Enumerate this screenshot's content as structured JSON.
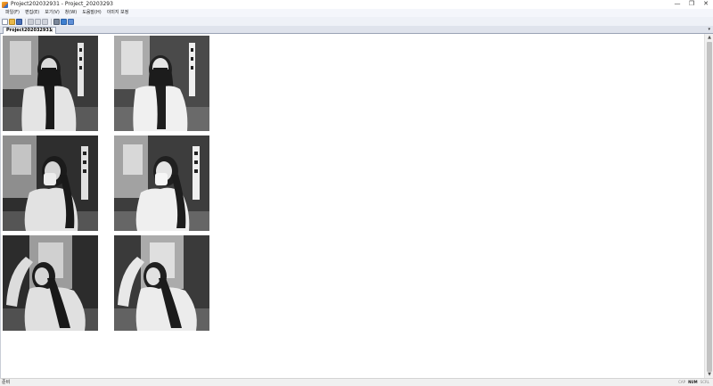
{
  "window": {
    "title": "Project202032931 - Project_20203293",
    "controls": {
      "minimize": "—",
      "maximize": "❐",
      "close": "✕"
    }
  },
  "menu": [
    "파일(F)",
    "편집(E)",
    "보기(V)",
    "창(W)",
    "도움말(H)",
    "이미지 보정"
  ],
  "toolbar": {
    "icons": [
      "new-file-icon",
      "open-folder-icon",
      "save-icon",
      "cut-icon",
      "copy-icon",
      "paste-icon",
      "print-icon",
      "about-icon",
      "help-icon"
    ]
  },
  "tabs": {
    "active_label": "Project202032931",
    "close": "✕",
    "dropdown": "▾"
  },
  "tiles": [
    {
      "name": "image-original-1",
      "pose": "face-mask"
    },
    {
      "name": "image-processed-1",
      "pose": "face-mask"
    },
    {
      "name": "image-original-2",
      "pose": "hand-cover"
    },
    {
      "name": "image-processed-2",
      "pose": "hand-cover"
    },
    {
      "name": "image-original-3",
      "pose": "arm-raised"
    },
    {
      "name": "image-processed-3",
      "pose": "arm-raised"
    }
  ],
  "scrollbar": {
    "up": "▲",
    "down": "▼"
  },
  "status": {
    "text": "준비",
    "indicators": [
      {
        "label": "CAP",
        "on": false
      },
      {
        "label": "NUM",
        "on": true
      },
      {
        "label": "SCRL",
        "on": false
      }
    ]
  },
  "colors": {
    "titlebar": "#ffffff",
    "menubar": "#f4f6fb",
    "client": "#ffffff",
    "status": "#f0f0f0"
  }
}
